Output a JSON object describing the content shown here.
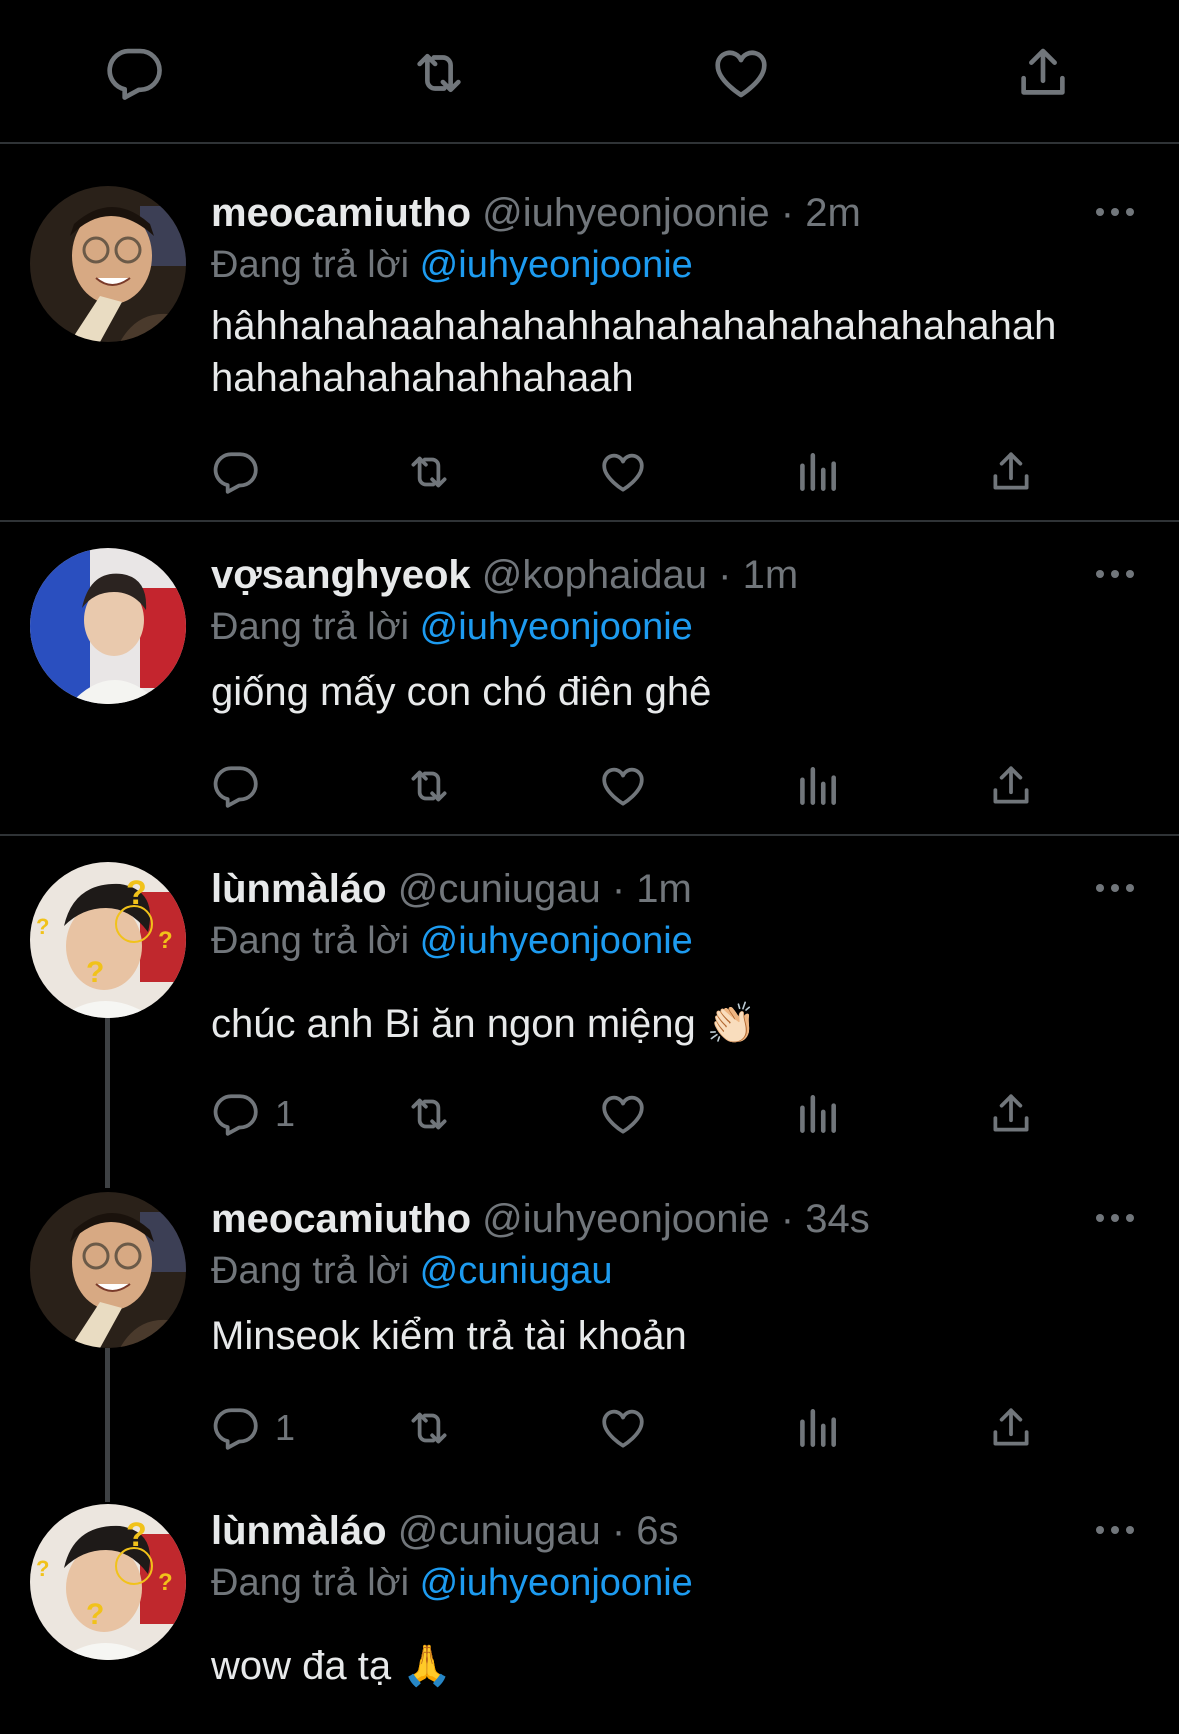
{
  "colors": {
    "background": "#000000",
    "text": "#e7e9ea",
    "muted": "#71767b",
    "link": "#1d9bf0",
    "divider": "#2f3336"
  },
  "top_actions": [
    "reply-icon",
    "retweet-icon",
    "like-icon",
    "share-icon"
  ],
  "tweets": [
    {
      "name": "meocamiutho",
      "handle": "@iuhyeonjoonie",
      "sep": "·",
      "time": "2m",
      "reply_prefix": "Đang trả lời",
      "reply_to": "@iuhyeonjoonie",
      "text": "hâhhahahaahahahahhahahahahahahahahahah hahahahahahahhahaah",
      "reply_count": ""
    },
    {
      "name": "vợsanghyeok",
      "handle": "@kophaidau",
      "sep": "·",
      "time": "1m",
      "reply_prefix": "Đang trả lời",
      "reply_to": "@iuhyeonjoonie",
      "text": "giống mấy con chó điên ghê",
      "reply_count": ""
    },
    {
      "name": "lùnmàláo",
      "handle": "@cuniugau",
      "sep": "·",
      "time": "1m",
      "reply_prefix": "Đang trả lời",
      "reply_to": "@iuhyeonjoonie",
      "text": "chúc anh Bi ăn ngon miệng 👏🏻",
      "reply_count": "1"
    },
    {
      "name": "meocamiutho",
      "handle": "@iuhyeonjoonie",
      "sep": "·",
      "time": "34s",
      "reply_prefix": "Đang trả lời",
      "reply_to": "@cuniugau",
      "text": "Minseok kiểm trả tài khoản",
      "reply_count": "1"
    },
    {
      "name": "lùnmàláo",
      "handle": "@cuniugau",
      "sep": "·",
      "time": "6s",
      "reply_prefix": "Đang trả lời",
      "reply_to": "@iuhyeonjoonie",
      "text": "wow đa tạ 🙏",
      "reply_count": ""
    }
  ]
}
